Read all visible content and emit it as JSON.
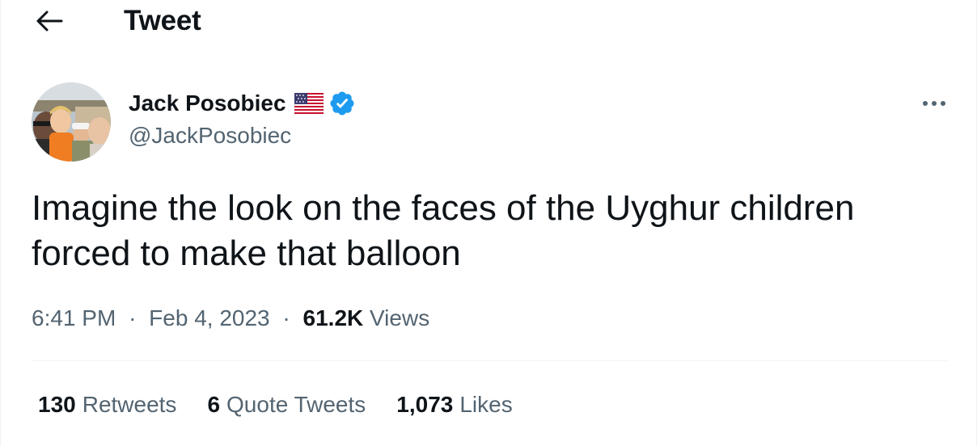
{
  "header": {
    "title": "Tweet",
    "back_icon": "arrow-left-icon"
  },
  "author": {
    "name": "Jack Posobiec",
    "handle": "@JackPosobiec",
    "badges": [
      "us-flag-icon",
      "verified-icon"
    ],
    "verified_color": "#1d9bf0"
  },
  "menu_icon": "more-horizontal-icon",
  "tweet": {
    "text_line1": "Imagine the look on the faces of the Uyghur children",
    "text_line2": "forced to make that balloon",
    "time": "6:41 PM",
    "separator": "·",
    "date": "Feb 4, 2023",
    "views_count": "61.2K",
    "views_label": "Views"
  },
  "stats": {
    "retweets_count": "130",
    "retweets_label": "Retweets",
    "quotes_count": "6",
    "quotes_label": "Quote Tweets",
    "likes_count": "1,073",
    "likes_label": "Likes"
  },
  "colors": {
    "text_primary": "#0f1419",
    "text_secondary": "#536471",
    "divider": "#eff3f4",
    "accent": "#1d9bf0"
  }
}
